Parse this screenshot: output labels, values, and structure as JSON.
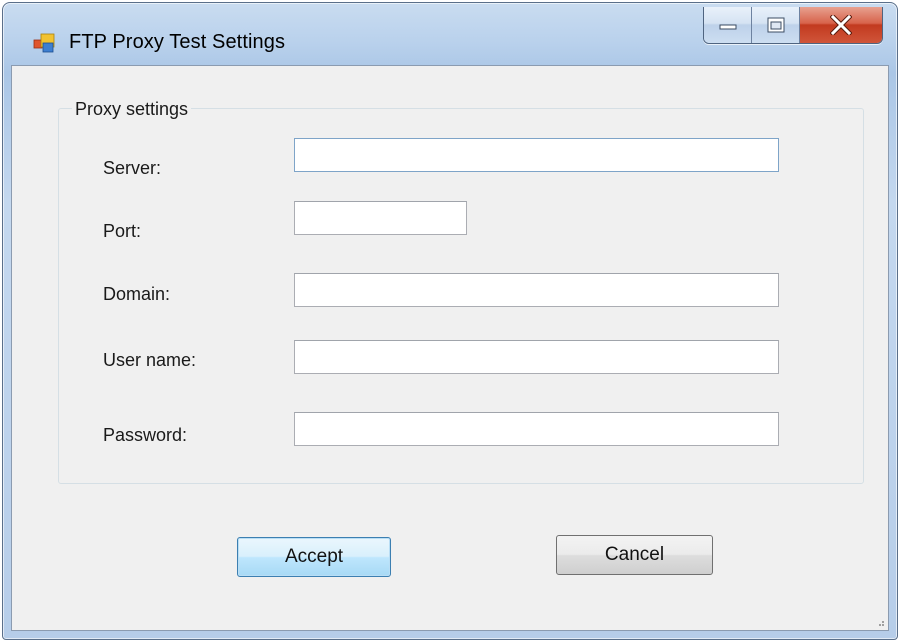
{
  "window": {
    "title": "FTP Proxy Test Settings",
    "controls": {
      "minimize_icon": "minimize-icon",
      "maximize_icon": "maximize-icon",
      "close_icon": "close-icon"
    }
  },
  "group": {
    "label": "Proxy settings"
  },
  "fields": {
    "server": {
      "label": "Server:",
      "value": ""
    },
    "port": {
      "label": "Port:",
      "value": ""
    },
    "domain": {
      "label": "Domain:",
      "value": ""
    },
    "username": {
      "label": "User name:",
      "value": ""
    },
    "password": {
      "label": "Password:",
      "value": ""
    }
  },
  "buttons": {
    "accept": "Accept",
    "cancel": "Cancel"
  },
  "colors": {
    "accent": "#3c7fb1",
    "close": "#c23a1f",
    "client_bg": "#f0f0f0"
  }
}
